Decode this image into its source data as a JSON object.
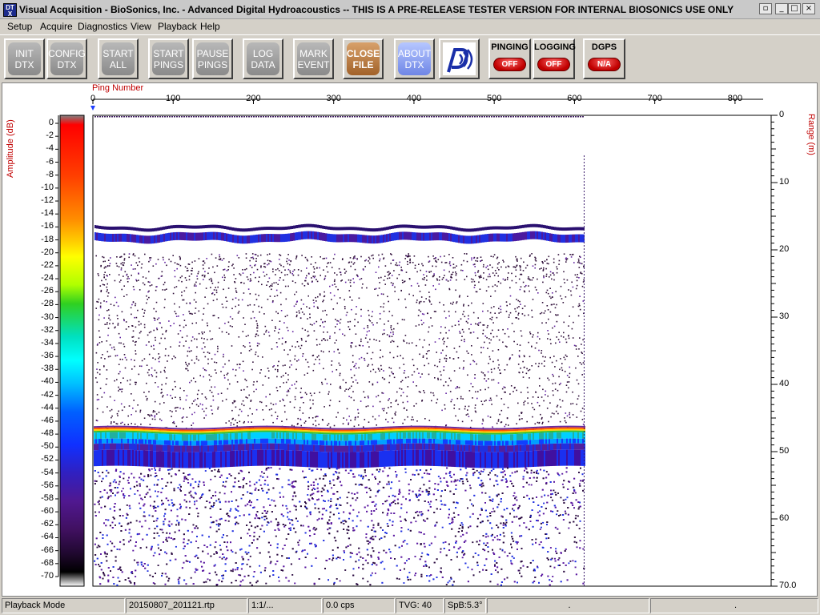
{
  "window": {
    "title": "Visual Acquisition  -  BioSonics, Inc.  -  Advanced Digital Hydroacoustics  -- THIS IS A PRE-RELEASE TESTER VERSION FOR INTERNAL BIOSONICS USE ONLY",
    "app_icon_text": "DT X",
    "controls": {
      "restore": "▫",
      "minimize": "_",
      "maximize": "□",
      "close": "×"
    }
  },
  "menu": [
    "Setup",
    "Acquire",
    "Diagnostics",
    "View",
    "Playback",
    "Help"
  ],
  "toolbar": {
    "buttons": [
      {
        "line1": "INIT",
        "line2": "DTX",
        "style": "gray"
      },
      {
        "line1": "CONFIG",
        "line2": "DTX",
        "style": "gray"
      },
      {
        "line1": "START",
        "line2": "ALL",
        "style": "gray"
      },
      {
        "line1": "START",
        "line2": "PINGS",
        "style": "gray"
      },
      {
        "line1": "PAUSE",
        "line2": "PINGS",
        "style": "gray"
      },
      {
        "line1": "LOG",
        "line2": "DATA",
        "style": "gray"
      },
      {
        "line1": "MARK",
        "line2": "EVENT",
        "style": "gray"
      },
      {
        "line1": "CLOSE",
        "line2": "FILE",
        "style": "orange"
      },
      {
        "line1": "ABOUT",
        "line2": "DTX",
        "style": "blue"
      }
    ],
    "indicators": [
      {
        "label": "PINGING",
        "state": "OFF"
      },
      {
        "label": "LOGGING",
        "state": "OFF"
      },
      {
        "label": "DGPS",
        "state": "N/A"
      }
    ]
  },
  "echogram": {
    "ping_axis_label": "Ping Number",
    "ping_ticks": [
      "0",
      "100",
      "200",
      "300",
      "400",
      "500",
      "600",
      "700",
      "800"
    ],
    "range_axis_label": "Range (m)",
    "range_ticks": [
      "0",
      "10",
      "20",
      "30",
      "40",
      "50",
      "60",
      "70.0"
    ],
    "amplitude_label": "Amplitude (dB)",
    "amplitude_ticks": [
      "0",
      "-2",
      "-4",
      "-6",
      "-8",
      "-10",
      "-12",
      "-14",
      "-16",
      "-18",
      "-20",
      "-22",
      "-24",
      "-26",
      "-28",
      "-30",
      "-32",
      "-34",
      "-36",
      "-38",
      "-40",
      "-42",
      "-44",
      "-46",
      "-48",
      "-50",
      "-52",
      "-54",
      "-56",
      "-58",
      "-60",
      "-62",
      "-64",
      "-66",
      "-68",
      "-70"
    ],
    "pings_recorded": 612,
    "surface_layer_range_m": [
      16.5,
      20.0
    ],
    "bottom_range_m": 46.8,
    "colors": {
      "axis_label": "#c00000",
      "background": "#ffffff"
    }
  },
  "status": {
    "mode": "Playback Mode",
    "file": "20150807_201121.rtp",
    "ratio": "1:1/...",
    "rate": "0.0 cps",
    "tvg": "TVG: 40",
    "spb": "SpB:5.3°",
    "field7": ".",
    "field8": "."
  }
}
